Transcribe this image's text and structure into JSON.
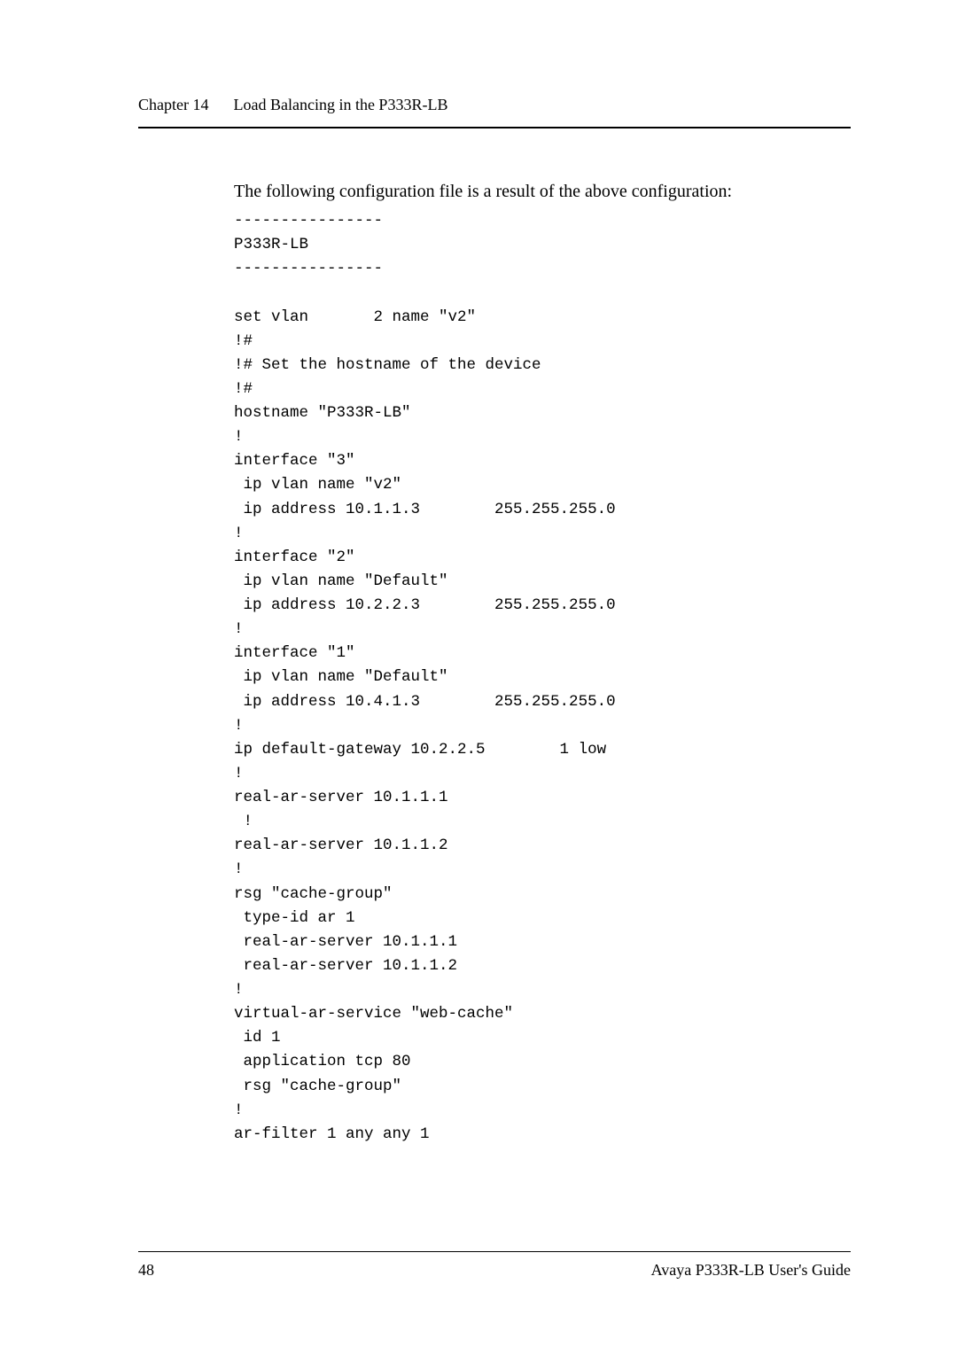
{
  "header": {
    "chapter": "Chapter 14",
    "title": "Load Balancing in the P333R-LB"
  },
  "intro": "The following configuration file is a result of the above configuration:",
  "config_text": "----------------\nP333R-LB\n----------------\n\nset vlan       2 name \"v2\"\n!#\n!# Set the hostname of the device\n!#\nhostname \"P333R-LB\"\n!\ninterface \"3\"\n ip vlan name \"v2\"\n ip address 10.1.1.3        255.255.255.0\n!\ninterface \"2\"\n ip vlan name \"Default\"\n ip address 10.2.2.3        255.255.255.0\n!\ninterface \"1\"\n ip vlan name \"Default\"\n ip address 10.4.1.3        255.255.255.0\n!\nip default-gateway 10.2.2.5        1 low\n!\nreal-ar-server 10.1.1.1\n !\nreal-ar-server 10.1.1.2\n!\nrsg \"cache-group\"\n type-id ar 1\n real-ar-server 10.1.1.1\n real-ar-server 10.1.1.2\n!\nvirtual-ar-service \"web-cache\"\n id 1\n application tcp 80\n rsg \"cache-group\"\n!\nar-filter 1 any any 1",
  "footer": {
    "page": "48",
    "guide": "Avaya P333R-LB User's Guide"
  }
}
